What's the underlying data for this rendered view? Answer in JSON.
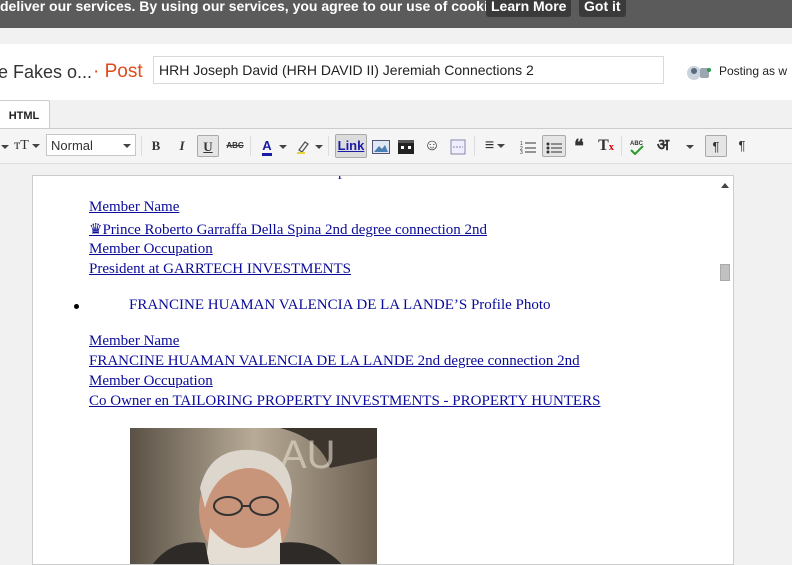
{
  "cookie": {
    "message": "deliver our services. By using our services, you agree to our use of cookies.",
    "learn_more": "Learn More",
    "got_it": "Got it"
  },
  "header": {
    "blog_name": "e Fakes o...",
    "post_label": "· Post",
    "post_title": "HRH Joseph David (HRH DAVID II) Jeremiah Connections 2",
    "posting_as": "Posting as w"
  },
  "mode_tab": "HTML",
  "toolbar": {
    "format": "Normal",
    "bold": "B",
    "italic": "I",
    "underline": "U",
    "strike": "ABC",
    "text_color": "A",
    "link": "Link",
    "quote": "❝",
    "hindi": "अ",
    "icons": [
      "text-size-icon",
      "bold-icon",
      "italic-icon",
      "underline-icon",
      "strikethrough-icon",
      "text-color-icon",
      "highlight-icon",
      "link-icon",
      "image-icon",
      "video-icon",
      "emoji-icon",
      "jump-break-icon",
      "align-icon",
      "numbered-list-icon",
      "bullet-list-icon",
      "quote-icon",
      "clear-format-icon",
      "spell-check-icon",
      "transliterate-icon",
      "ltr-icon",
      "rtl-icon"
    ]
  },
  "editor": {
    "entry1": {
      "member_name": "Member Name",
      "name_line": "Prince Roberto Garraffa Della Spina 2nd degree connection 2nd",
      "crown": "♛",
      "occupation_label": "Member Occupation",
      "occupation": "President at GARRTECH INVESTMENTS"
    },
    "entry2": {
      "profile_photo": "FRANCINE HUAMAN VALENCIA DE LA LANDE’S Profile Photo",
      "member_name": "Member Name",
      "name_line": "FRANCINE HUAMAN VALENCIA DE LA LANDE 2nd degree connection 2nd",
      "occupation_label": "Member Occupation",
      "occupation": "Co Owner en TAILORING PROPERTY INVESTMENTS - PROPERTY HUNTERS"
    }
  }
}
